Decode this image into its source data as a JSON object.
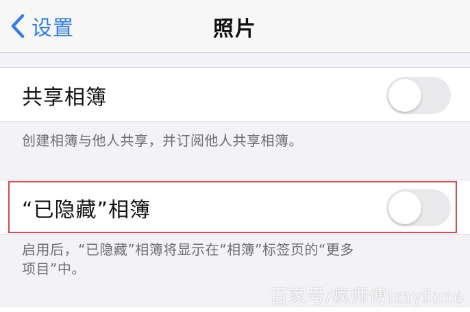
{
  "nav": {
    "back_label": "设置",
    "title": "照片"
  },
  "shared_albums": {
    "label": "共享相簿",
    "toggle_on": false,
    "footer": "创建相簿与他人共享，并订阅他人共享相簿。"
  },
  "hidden_album": {
    "label": "“已隐藏”相簿",
    "toggle_on": false,
    "footer_line1": "启用后，“已隐藏”相簿将显示在“相簿”标签页的“更多",
    "footer_line2": "项目”中。"
  },
  "watermark": "百家号/疯师傅imyfone",
  "colors": {
    "accent": "#2f7cf6",
    "highlight_border": "#e04848",
    "toggle_off": "#e9e9eb"
  },
  "icons": {
    "back": "chevron-left-icon"
  }
}
